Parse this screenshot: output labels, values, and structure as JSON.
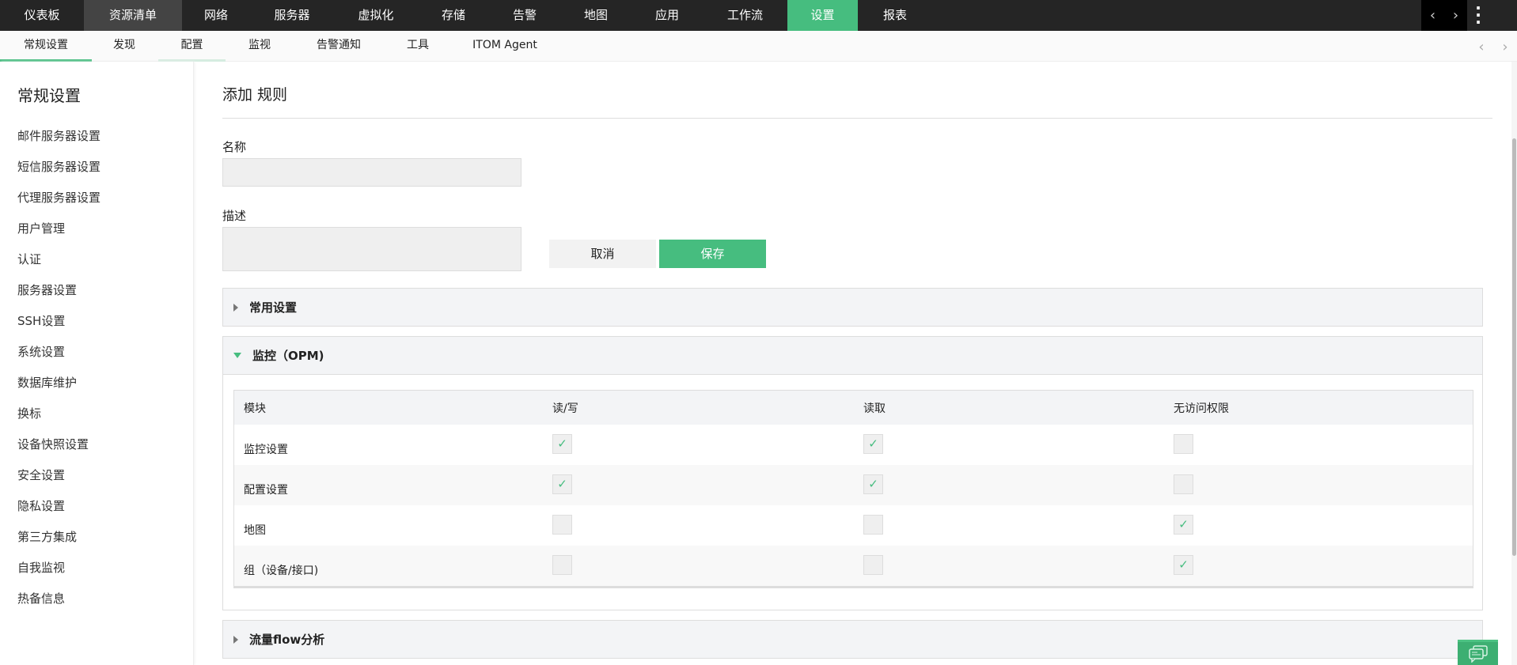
{
  "top_nav": {
    "items": [
      "仪表板",
      "资源清单",
      "网络",
      "服务器",
      "虚拟化",
      "存储",
      "告警",
      "地图",
      "应用",
      "工作流",
      "设置",
      "报表"
    ],
    "hovered": "资源清单",
    "active": "设置"
  },
  "sub_nav": {
    "items": [
      "常规设置",
      "发现",
      "配置",
      "监视",
      "告警通知",
      "工具",
      "ITOM Agent"
    ],
    "active": "常规设置"
  },
  "sidebar": {
    "title": "常规设置",
    "items": [
      "邮件服务器设置",
      "短信服务器设置",
      "代理服务器设置",
      "用户管理",
      "认证",
      "服务器设置",
      "SSH设置",
      "系统设置",
      "数据库维护",
      "换标",
      "设备快照设置",
      "安全设置",
      "隐私设置",
      "第三方集成",
      "自我监视",
      "热备信息"
    ]
  },
  "form": {
    "title": "添加 规则",
    "name_label": "名称",
    "name_value": "",
    "desc_label": "描述",
    "desc_value": "",
    "cancel": "取消",
    "save": "保存"
  },
  "sections": {
    "common": "常用设置",
    "monitor": "监控（OPM)",
    "flow": "流量flow分析"
  },
  "table": {
    "headers": [
      "模块",
      "读/写",
      "读取",
      "无访问权限"
    ],
    "rows": [
      {
        "module": "监控设置",
        "read_write": true,
        "read": true,
        "no_access": false
      },
      {
        "module": "配置设置",
        "read_write": true,
        "read": true,
        "no_access": false
      },
      {
        "module": "地图",
        "read_write": false,
        "read": false,
        "no_access": true
      },
      {
        "module": "组（设备/接口)",
        "read_write": false,
        "read": false,
        "no_access": true
      }
    ]
  },
  "colors": {
    "accent": "#46bd7f",
    "topbar": "#252525"
  }
}
